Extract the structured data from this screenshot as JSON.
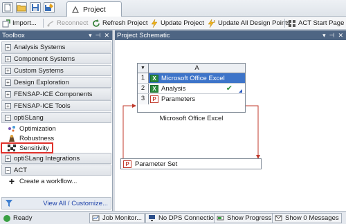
{
  "window": {
    "tab_label": "Project"
  },
  "toolbar": {
    "import_label": "Import...",
    "reconnect_label": "Reconnect",
    "refresh_label": "Refresh Project",
    "update_label": "Update Project",
    "update_all_label": "Update All Design Points",
    "act_label": "ACT Start Page"
  },
  "toolbox": {
    "title": "Toolbox",
    "categories": [
      {
        "label": "Analysis Systems",
        "state": "+"
      },
      {
        "label": "Component Systems",
        "state": "+"
      },
      {
        "label": "Custom Systems",
        "state": "+"
      },
      {
        "label": "Design Exploration",
        "state": "+"
      },
      {
        "label": "FENSAP-ICE Components",
        "state": "+"
      },
      {
        "label": "FENSAP-ICE Tools",
        "state": "+"
      },
      {
        "label": "optiSLang",
        "state": "−"
      }
    ],
    "optislang_items": [
      "Optimization",
      "Robustness",
      "Sensitivity"
    ],
    "categories_after": [
      {
        "label": "optiSLang Integrations",
        "state": "+"
      },
      {
        "label": "ACT",
        "state": "−"
      }
    ],
    "act_items": [
      "Create a workflow..."
    ],
    "footer_link": "View All / Customize..."
  },
  "schematic": {
    "title": "Project Schematic",
    "system": {
      "column": "A",
      "rows": [
        {
          "num": "1",
          "label": "Microsoft Office Excel"
        },
        {
          "num": "2",
          "label": "Analysis"
        },
        {
          "num": "3",
          "label": "Parameters"
        }
      ],
      "caption": "Microsoft Office Excel"
    },
    "parameter_set": "Parameter Set"
  },
  "statusbar": {
    "ready": "Ready",
    "job_monitor": "Job Monitor...",
    "dps": "No DPS Connection",
    "progress": "Show Progress",
    "messages": "Show 0 Messages"
  },
  "colors": {
    "panel_header": "#4e6583",
    "selection": "#3d74c9",
    "highlight_box": "#e0312b",
    "link_arrow": "#c0392b"
  }
}
